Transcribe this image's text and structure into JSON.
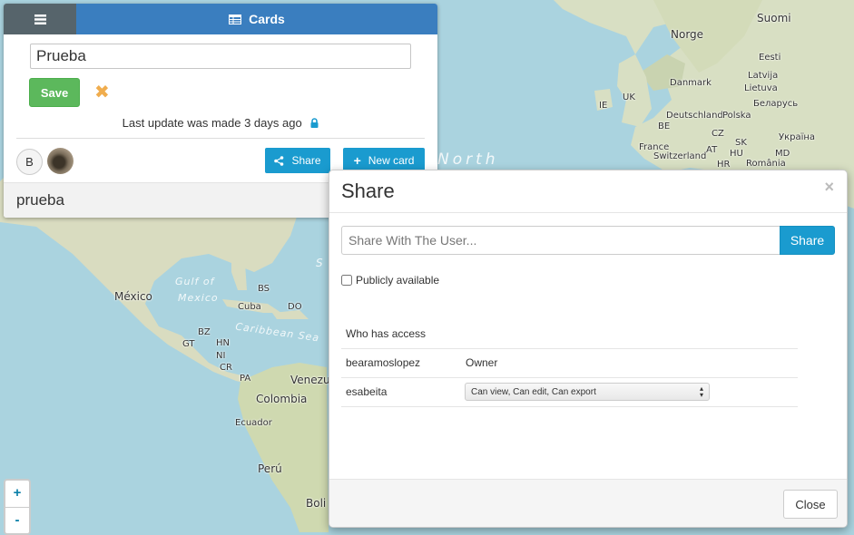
{
  "map": {
    "labels": {
      "suomi": "Suomi",
      "norge": "Norge",
      "eesti": "Eesti",
      "latvija": "Latvija",
      "lietuva": "Lietuva",
      "danmark": "Danmark",
      "uk": "UK",
      "ie": "IE",
      "belarus": "Беларусь",
      "deutschland": "Deutschland",
      "polska": "Polska",
      "be": "BE",
      "cz": "CZ",
      "ukraina": "Україна",
      "france": "France",
      "at": "AT",
      "switzerland": "Switzerland",
      "hu": "HU",
      "md": "MD",
      "hr": "HR",
      "romania": "România",
      "sk": "SK",
      "mexico": "México",
      "gulf_of_mexico_1": "Gulf of",
      "gulf_of_mexico_2": "Mexico",
      "bs": "BS",
      "cuba": "Cuba",
      "do": "DO",
      "bz": "BZ",
      "gt": "GT",
      "hn": "HN",
      "ni": "NI",
      "cr": "CR",
      "pa": "PA",
      "caribbean_sea": "Caribbean Sea",
      "venezuela": "Venezu",
      "colombia": "Colombia",
      "ecuador": "Ecuador",
      "peru": "Perú",
      "bolivia": "Boli",
      "north": "North",
      "sea_s": "S"
    }
  },
  "zoom": {
    "in": "+",
    "out": "-"
  },
  "cards_panel": {
    "header": {
      "title": "Cards",
      "menu_icon": "hamburger-icon",
      "title_icon": "table-icon"
    },
    "card_name": "Prueba",
    "save_label": "Save",
    "last_update": "Last update was made 3 days ago",
    "avatar_initial": "B",
    "share_label": "Share",
    "new_card_label": "New card",
    "card_item": "prueba"
  },
  "share_modal": {
    "title": "Share",
    "close_x": "×",
    "user_placeholder": "Share With The User...",
    "share_button": "Share",
    "publicly_available": "Publicly available",
    "publicly_checked": false,
    "access_header": "Who has access",
    "rows": [
      {
        "user": "bearamoslopez",
        "permission": "Owner"
      },
      {
        "user": "esabeita",
        "permission": "Can view, Can edit, Can export"
      }
    ],
    "close_button": "Close"
  },
  "colors": {
    "primary_blue": "#1a9bcf",
    "header_blue": "#3a7ebf",
    "save_green": "#5cb85c",
    "cancel_orange": "#f0ad4e",
    "sea": "#aad3df"
  }
}
